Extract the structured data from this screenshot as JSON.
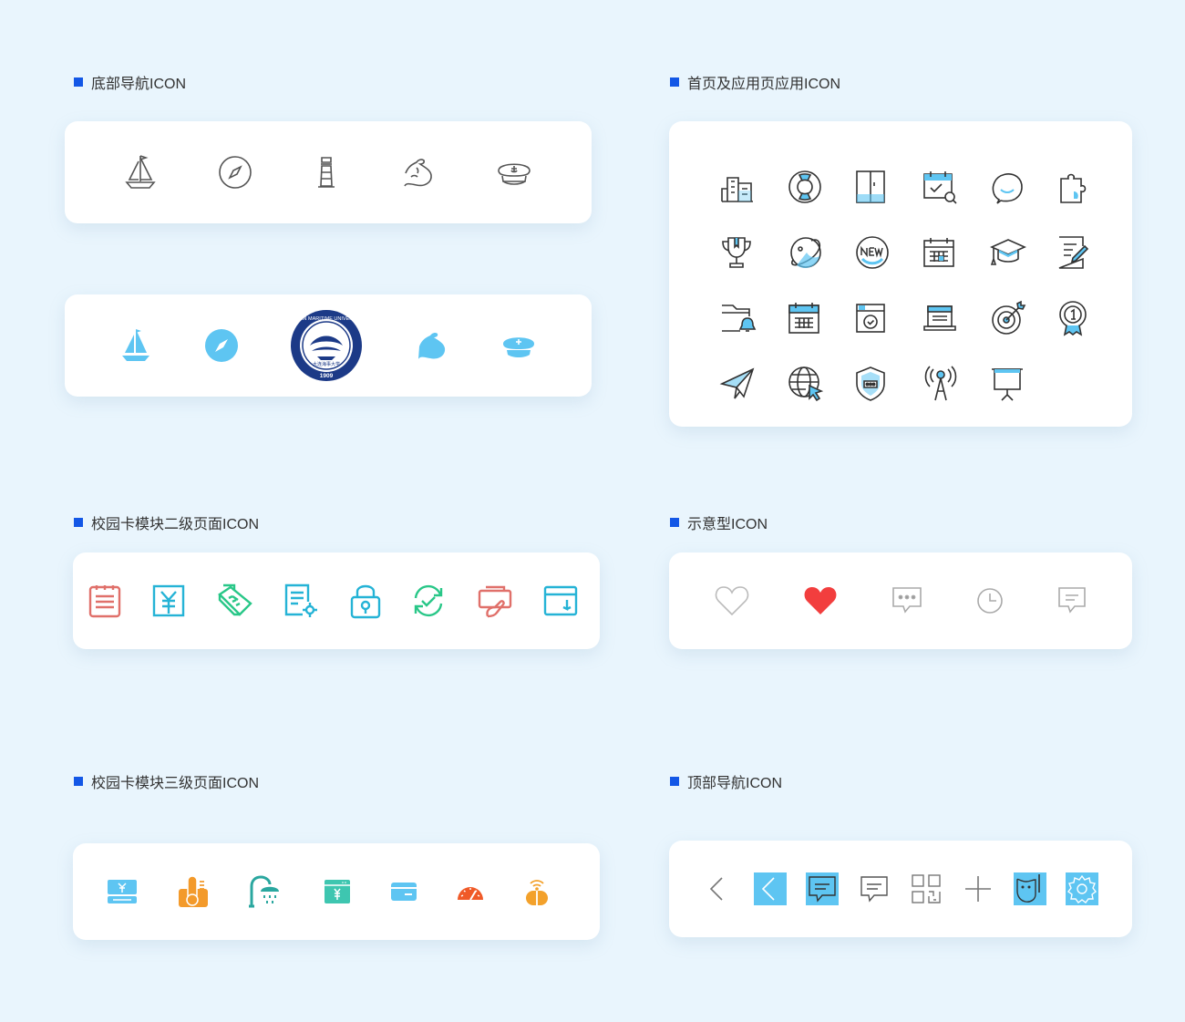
{
  "sections": {
    "bottom_nav": {
      "title": "底部导航ICON"
    },
    "home_apps": {
      "title": "首页及应用页应用ICON"
    },
    "card_level2": {
      "title": "校园卡模块二级页面ICON"
    },
    "indicator": {
      "title": "示意型ICON"
    },
    "card_level3": {
      "title": "校园卡模块三级页面ICON"
    },
    "top_nav": {
      "title": "顶部导航ICON"
    }
  },
  "logo": {
    "outer_text": "DALIAN MARITIME UNIVERSITY",
    "inner_text": "大连海事大学",
    "year": "1909"
  },
  "icons": {
    "bottom_nav_outline": [
      "sailboat-icon",
      "compass-icon",
      "lighthouse-icon",
      "muscle-arm-icon",
      "captain-hat-icon"
    ],
    "bottom_nav_filled": [
      "sailboat-icon",
      "compass-icon",
      "university-logo",
      "muscle-arm-icon",
      "captain-hat-icon"
    ],
    "home_apps": [
      "buildings-icon",
      "lifebuoy-icon",
      "locker-icon",
      "calendar-search-icon",
      "chat-bubble-icon",
      "puzzle-icon",
      "trophy-icon",
      "planet-icon",
      "new-badge-icon",
      "calendar-grid-icon",
      "graduation-cap-icon",
      "edit-note-icon",
      "folder-bell-icon",
      "calendar-icon",
      "window-check-icon",
      "laptop-icon",
      "target-icon",
      "medal-icon",
      "paper-plane-icon",
      "globe-cursor-icon",
      "shield-password-icon",
      "antenna-icon",
      "presentation-board-icon"
    ],
    "card_level2": [
      "notepad-icon",
      "yuan-card-icon",
      "pos-terminal-icon",
      "document-settings-icon",
      "lock-icon",
      "refresh-check-icon",
      "card-hand-icon",
      "wallet-screen-icon"
    ],
    "indicator": [
      "heart-outline-icon",
      "heart-filled-icon",
      "message-dots-icon",
      "clock-icon",
      "message-lines-icon"
    ],
    "card_level3": [
      "yuan-terminal-icon",
      "thermometer-icon",
      "shower-icon",
      "yuan-window-icon",
      "bank-card-icon",
      "speedometer-icon",
      "wifi-tag-icon"
    ],
    "top_nav": [
      "back-arrow-icon",
      "back-arrow-filled-icon",
      "comment-filled-icon",
      "comment-icon",
      "qr-code-icon",
      "plus-icon",
      "palette-filled-icon",
      "settings-filled-icon"
    ]
  },
  "colors": {
    "background": "#e9f5fd",
    "accent_blue": "#1357e6",
    "light_blue": "#5ec5f2",
    "heart_red": "#f23e3e",
    "logo_navy": "#1c3a87"
  }
}
